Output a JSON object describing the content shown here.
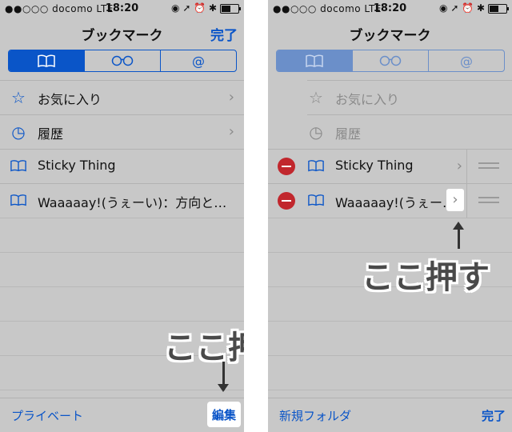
{
  "left": {
    "status": {
      "carrier": "●●○○○ docomo  LTE",
      "time": "18:20",
      "icons": "◉ ➚ ⏰ ✱"
    },
    "title": "ブックマーク",
    "done": "完了",
    "segments": {
      "book": "📖",
      "glasses": "○○",
      "at": "@"
    },
    "rows": [
      {
        "icon": "☆",
        "label": "お気に入り",
        "chevron": "›"
      },
      {
        "icon": "◷",
        "label": "履歴",
        "chevron": "›"
      },
      {
        "icon": "📖",
        "label": "Sticky Thing",
        "chevron": ""
      },
      {
        "icon": "📖",
        "label": "Waaaaay!(うぇーい)：方向と…",
        "chevron": ""
      }
    ],
    "toolbar": {
      "left": "プライベート",
      "right": "編集"
    },
    "annotation": "ここ押す"
  },
  "right": {
    "status": {
      "carrier": "●●○○○ docomo  LTE",
      "time": "18:20",
      "icons": "◉ ➚ ⏰ ✱"
    },
    "title": "ブックマーク",
    "segments": {
      "book": "📖",
      "glasses": "○○",
      "at": "@"
    },
    "rows": [
      {
        "icon": "☆",
        "label": "お気に入り"
      },
      {
        "icon": "◷",
        "label": "履歴"
      },
      {
        "icon": "📖",
        "label": "Sticky Thing",
        "chevron": "›"
      },
      {
        "icon": "📖",
        "label": "Waaaaay!(うぇー…",
        "chevron": "›"
      }
    ],
    "toolbar": {
      "left": "新規フォルダ",
      "right": "完了"
    },
    "annotation": "ここ押す"
  }
}
